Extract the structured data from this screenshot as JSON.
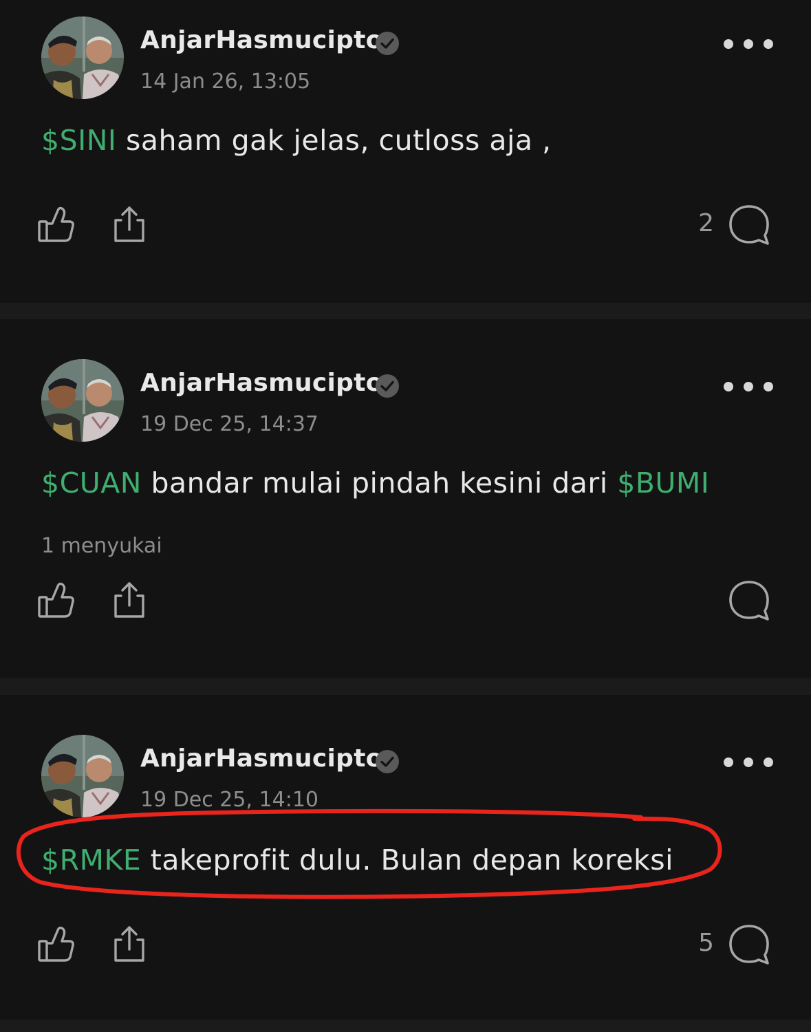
{
  "colors": {
    "background": "#131313",
    "separator": "#1b1b1b",
    "ticker": "#3fae70",
    "muted": "#8d8d8d",
    "highlight_ring": "#e8241c"
  },
  "posts": [
    {
      "username": "AnjarHasmucipto",
      "verified_icon": "verified-check-icon",
      "timestamp": "14 Jan 26, 13:05",
      "ticker1": "$SINI",
      "text1": " saham gak jelas, cutloss aja ,",
      "likes_text": "",
      "comment_count": "2"
    },
    {
      "username": "AnjarHasmucipto",
      "verified_icon": "verified-check-icon",
      "timestamp": "19 Dec 25, 14:37",
      "ticker1": "$CUAN",
      "text1": " bandar mulai pindah kesini dari ",
      "ticker2": "$BUMI",
      "likes_text": "1 menyukai",
      "comment_count": ""
    },
    {
      "username": "AnjarHasmucipto",
      "verified_icon": "verified-check-icon",
      "timestamp": "19 Dec 25, 14:10",
      "ticker1": "$RMKE",
      "text1": " takeprofit dulu. Bulan depan koreksi",
      "likes_text": "",
      "comment_count": "5"
    }
  ],
  "icons": {
    "like": "thumbs-up-icon",
    "share": "share-icon",
    "comment": "comment-bubble-icon",
    "more": "more-dots-icon"
  }
}
